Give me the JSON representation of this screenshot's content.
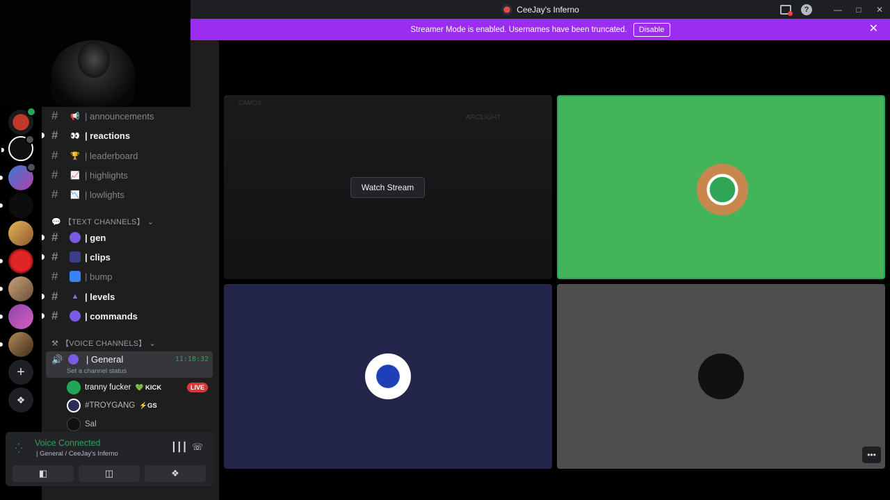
{
  "window": {
    "title": "CeeJay's Inferno"
  },
  "banner": {
    "message": "Streamer Mode is enabled. Usernames have been truncated.",
    "disable_label": "Disable",
    "color": "#9b2cf0"
  },
  "channels": [
    {
      "name": "| announcements",
      "emoji": "📢",
      "unread": false
    },
    {
      "name": "| reactions",
      "emoji": "👀",
      "unread": true
    },
    {
      "name": "| leaderboard",
      "emoji": "🏆",
      "unread": false
    },
    {
      "name": "| highlights",
      "emoji": "📈",
      "unread": false
    },
    {
      "name": "| lowlights",
      "emoji": "📉",
      "unread": false
    }
  ],
  "text_category": "【TEXT CHANNELS】",
  "text_channels": [
    {
      "name": "| gen",
      "unread": true
    },
    {
      "name": "| clips",
      "unread": true
    },
    {
      "name": "| bump",
      "unread": false
    },
    {
      "name": "| levels",
      "unread": true
    },
    {
      "name": "| commands",
      "unread": true
    }
  ],
  "voice_category": "【VOICE CHANNELS】",
  "voice_channel": {
    "name": "| General",
    "timer": "11:18:32",
    "status": "Set a channel status"
  },
  "members": [
    {
      "name": "tranny fucker",
      "tag": "💚 KICK",
      "live": true
    },
    {
      "name": "#TROYGANG",
      "tag": "⚡GS",
      "live": false
    },
    {
      "name": "Sal",
      "tag": "",
      "live": false
    }
  ],
  "live_label": "LIVE",
  "voice_panel": {
    "title": "Voice Connected",
    "subtitle": "| General / CeeJay's Inferno"
  },
  "stage": {
    "watch_label": "Watch Stream",
    "stream_ghost_title": "CAMOS",
    "stream_ghost_label": "ARCLIGHT"
  },
  "colors": {
    "accent_green": "#23a559",
    "tile_green": "#43b45a",
    "tile_navy": "#23244a",
    "tile_gray": "#4e4e4e"
  }
}
